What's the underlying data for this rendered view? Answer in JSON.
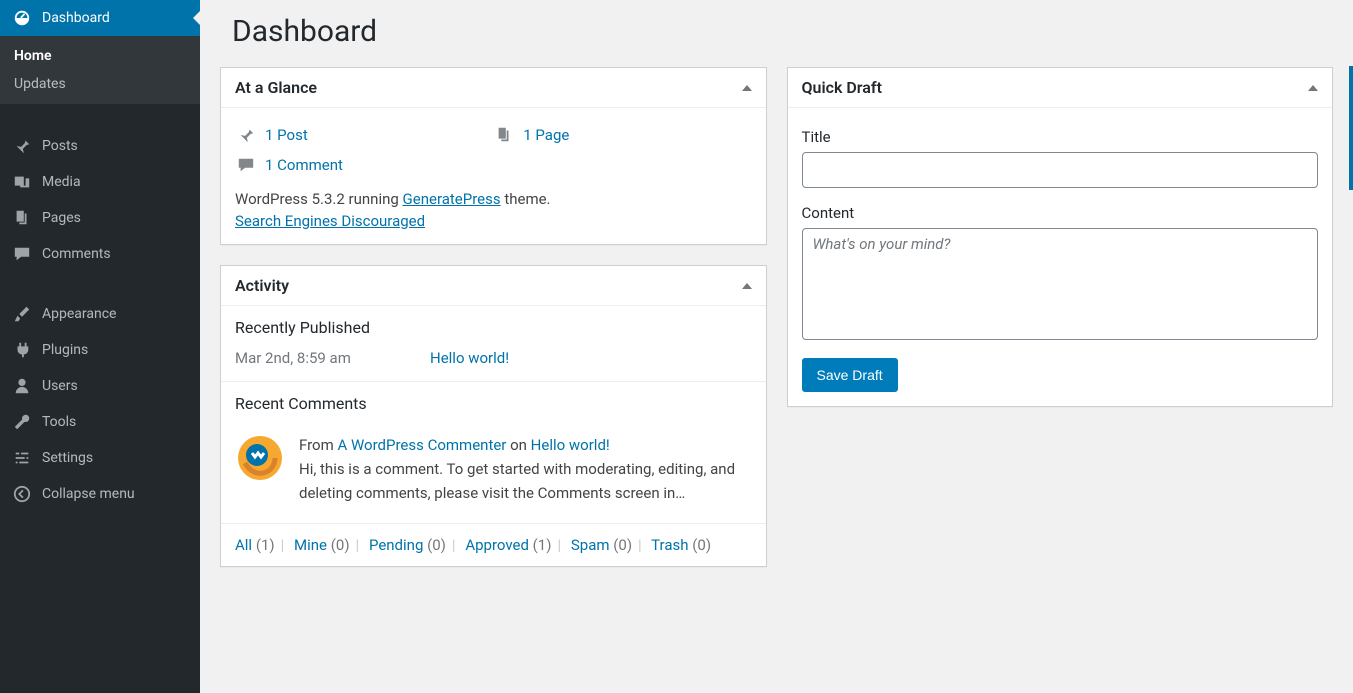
{
  "page": {
    "title": "Dashboard"
  },
  "menu": {
    "dashboard": "Dashboard",
    "home": "Home",
    "updates": "Updates",
    "posts": "Posts",
    "media": "Media",
    "pages": "Pages",
    "comments": "Comments",
    "appearance": "Appearance",
    "plugins": "Plugins",
    "users": "Users",
    "tools": "Tools",
    "settings": "Settings",
    "collapse": "Collapse menu"
  },
  "glance": {
    "title": "At a Glance",
    "posts": "1 Post",
    "pages": "1 Page",
    "comments": "1 Comment",
    "version_prefix": "WordPress 5.3.2 running ",
    "theme": "GeneratePress",
    "version_suffix": " theme.",
    "seo": "Search Engines Discouraged"
  },
  "activity": {
    "title": "Activity",
    "recently_published": "Recently Published",
    "pub_date": "Mar 2nd, 8:59 am",
    "pub_title": "Hello world!",
    "recent_comments": "Recent Comments",
    "comment_from": "From ",
    "comment_author": "A WordPress Commenter",
    "comment_on": " on ",
    "comment_post": "Hello world!",
    "comment_excerpt": "Hi, this is a comment. To get started with moderating, editing, and deleting comments, please visit the Comments screen in…",
    "filters": {
      "all": "All",
      "all_c": "(1)",
      "mine": "Mine",
      "mine_c": "(0)",
      "pending": "Pending",
      "pending_c": "(0)",
      "approved": "Approved",
      "approved_c": "(1)",
      "spam": "Spam",
      "spam_c": "(0)",
      "trash": "Trash",
      "trash_c": "(0)"
    }
  },
  "quickdraft": {
    "title": "Quick Draft",
    "title_label": "Title",
    "content_label": "Content",
    "content_placeholder": "What's on your mind?",
    "save": "Save Draft"
  }
}
